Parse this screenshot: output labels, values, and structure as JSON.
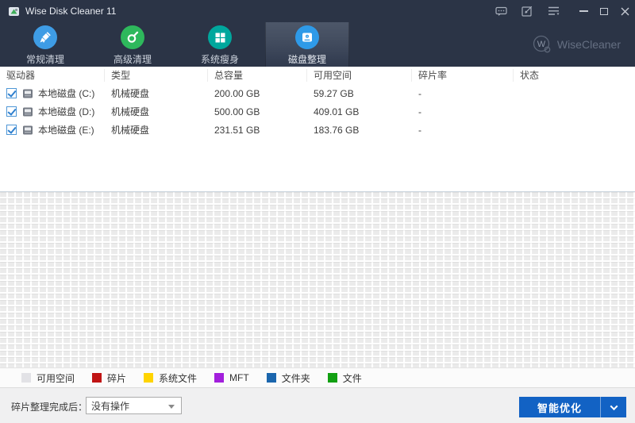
{
  "window": {
    "title": "Wise Disk Cleaner 11"
  },
  "toolbar": {
    "brand": "WiseCleaner",
    "tabs": [
      {
        "label": "常规清理",
        "icon": "broom-icon",
        "color": "#3e9ce5",
        "active": false
      },
      {
        "label": "高级清理",
        "icon": "sweeper-icon",
        "color": "#2eb85c",
        "active": false
      },
      {
        "label": "系统瘦身",
        "icon": "windows-icon",
        "color": "#00a79d",
        "active": false
      },
      {
        "label": "磁盘整理",
        "icon": "disk-icon",
        "color": "#2e9ae8",
        "active": true
      }
    ]
  },
  "table": {
    "columns": [
      "驱动器",
      "类型",
      "总容量",
      "可用空间",
      "碎片率",
      "状态"
    ],
    "rows": [
      {
        "checked": true,
        "drive": "本地磁盘 (C:)",
        "type": "机械硬盘",
        "total": "200.00 GB",
        "free": "59.27 GB",
        "frag": "-",
        "status": ""
      },
      {
        "checked": true,
        "drive": "本地磁盘 (D:)",
        "type": "机械硬盘",
        "total": "500.00 GB",
        "free": "409.01 GB",
        "frag": "-",
        "status": ""
      },
      {
        "checked": true,
        "drive": "本地磁盘 (E:)",
        "type": "机械硬盘",
        "total": "231.51 GB",
        "free": "183.76 GB",
        "frag": "-",
        "status": ""
      }
    ]
  },
  "legend": {
    "items": [
      {
        "label": "可用空间",
        "color": "#e2e2e6"
      },
      {
        "label": "碎片",
        "color": "#c01414"
      },
      {
        "label": "系统文件",
        "color": "#ffd400"
      },
      {
        "label": "MFT",
        "color": "#a21fdc"
      },
      {
        "label": "文件夹",
        "color": "#1b66ad"
      },
      {
        "label": "文件",
        "color": "#12a012"
      }
    ]
  },
  "footer": {
    "after_label": "碎片整理完成后：",
    "dropdown_value": "没有操作",
    "optimize_button": "智能优化"
  }
}
